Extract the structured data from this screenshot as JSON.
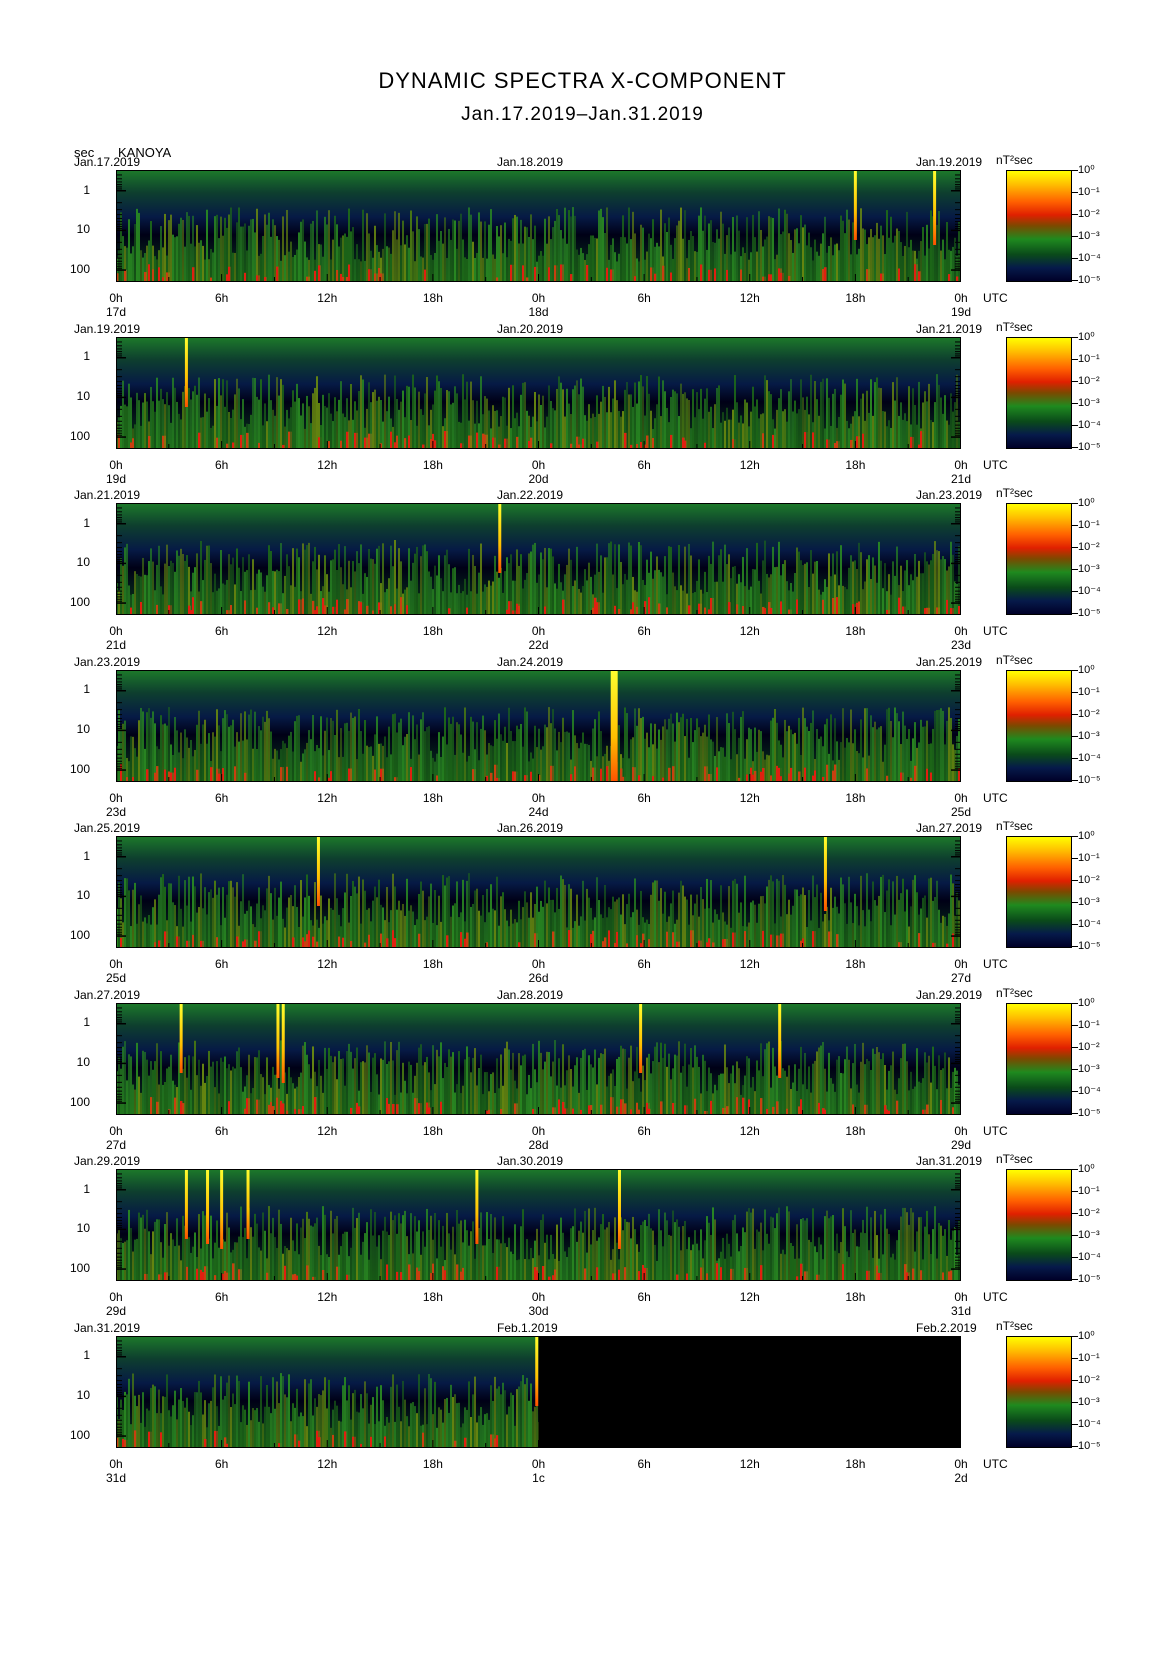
{
  "title": "DYNAMIC SPECTRA X-COMPONENT",
  "subtitle": "Jan.17.2019–Jan.31.2019",
  "ylabel_unit": "sec",
  "station": "KANOYA",
  "unit_label": "nT²sec",
  "utc_label": "UTC",
  "time_ticks": [
    "0h",
    "6h",
    "12h",
    "18h",
    "0h",
    "6h",
    "12h",
    "18h",
    "0h"
  ],
  "y_ticks": [
    "1",
    "10",
    "100"
  ],
  "colorbar_ticks": [
    "10⁰",
    "10⁻¹",
    "10⁻²",
    "10⁻³",
    "10⁻⁴",
    "10⁻⁵"
  ],
  "colors": {
    "high": "#ffff00",
    "mid": "#e02000",
    "low": "#1f8a1f",
    "floor": "#000028"
  },
  "chart_data": {
    "type": "heatmap",
    "title": "DYNAMIC SPECTRA X-COMPONENT",
    "xlabel": "UTC",
    "ylabel": "sec",
    "scale": "log",
    "y_range_sec": [
      0.3,
      200
    ],
    "panels": [
      {
        "date_left": "Jan.17.2019",
        "date_mid": "Jan.18.2019",
        "date_right": "Jan.19.2019",
        "day_labels": [
          "17d",
          "18d",
          "19d"
        ],
        "spikes_hour": [
          42,
          46.5
        ],
        "spike_type": [
          "thin",
          "thin"
        ],
        "blank_from_hour": null
      },
      {
        "date_left": "Jan.19.2019",
        "date_mid": "Jan.20.2019",
        "date_right": "Jan.21.2019",
        "day_labels": [
          "19d",
          "20d",
          "21d"
        ],
        "spikes_hour": [
          4
        ],
        "spike_type": [
          "thin"
        ],
        "blank_from_hour": null
      },
      {
        "date_left": "Jan.21.2019",
        "date_mid": "Jan.22.2019",
        "date_right": "Jan.23.2019",
        "day_labels": [
          "21d",
          "22d",
          "23d"
        ],
        "spikes_hour": [
          21.8
        ],
        "spike_type": [
          "thin"
        ],
        "blank_from_hour": null
      },
      {
        "date_left": "Jan.23.2019",
        "date_mid": "Jan.24.2019",
        "date_right": "Jan.25.2019",
        "day_labels": [
          "23d",
          "24d",
          "25d"
        ],
        "spikes_hour": [
          28.3
        ],
        "spike_type": [
          "wide"
        ],
        "blank_from_hour": null
      },
      {
        "date_left": "Jan.25.2019",
        "date_mid": "Jan.26.2019",
        "date_right": "Jan.27.2019",
        "day_labels": [
          "25d",
          "26d",
          "27d"
        ],
        "spikes_hour": [
          11.5,
          40.3
        ],
        "spike_type": [
          "thin",
          "thin"
        ],
        "blank_from_hour": null
      },
      {
        "date_left": "Jan.27.2019",
        "date_mid": "Jan.28.2019",
        "date_right": "Jan.29.2019",
        "day_labels": [
          "27d",
          "28d",
          "29d"
        ],
        "spikes_hour": [
          3.7,
          9.2,
          9.5,
          29.8,
          37.7
        ],
        "spike_type": [
          "thin",
          "thin",
          "thin",
          "thin",
          "thin"
        ],
        "blank_from_hour": null
      },
      {
        "date_left": "Jan.29.2019",
        "date_mid": "Jan.30.2019",
        "date_right": "Jan.31.2019",
        "day_labels": [
          "29d",
          "30d",
          "31d"
        ],
        "spikes_hour": [
          4,
          5.2,
          6,
          7.5,
          20.5,
          28.6
        ],
        "spike_type": [
          "thin",
          "thin",
          "thin",
          "thin",
          "thin",
          "thin"
        ],
        "blank_from_hour": null
      },
      {
        "date_left": "Jan.31.2019",
        "date_mid": "Feb.1.2019",
        "date_right": "Feb.2.2019",
        "day_labels": [
          "31d",
          "1c",
          "2d"
        ],
        "spikes_hour": [
          23.9
        ],
        "spike_type": [
          "thin"
        ],
        "blank_from_hour": 24
      }
    ]
  }
}
